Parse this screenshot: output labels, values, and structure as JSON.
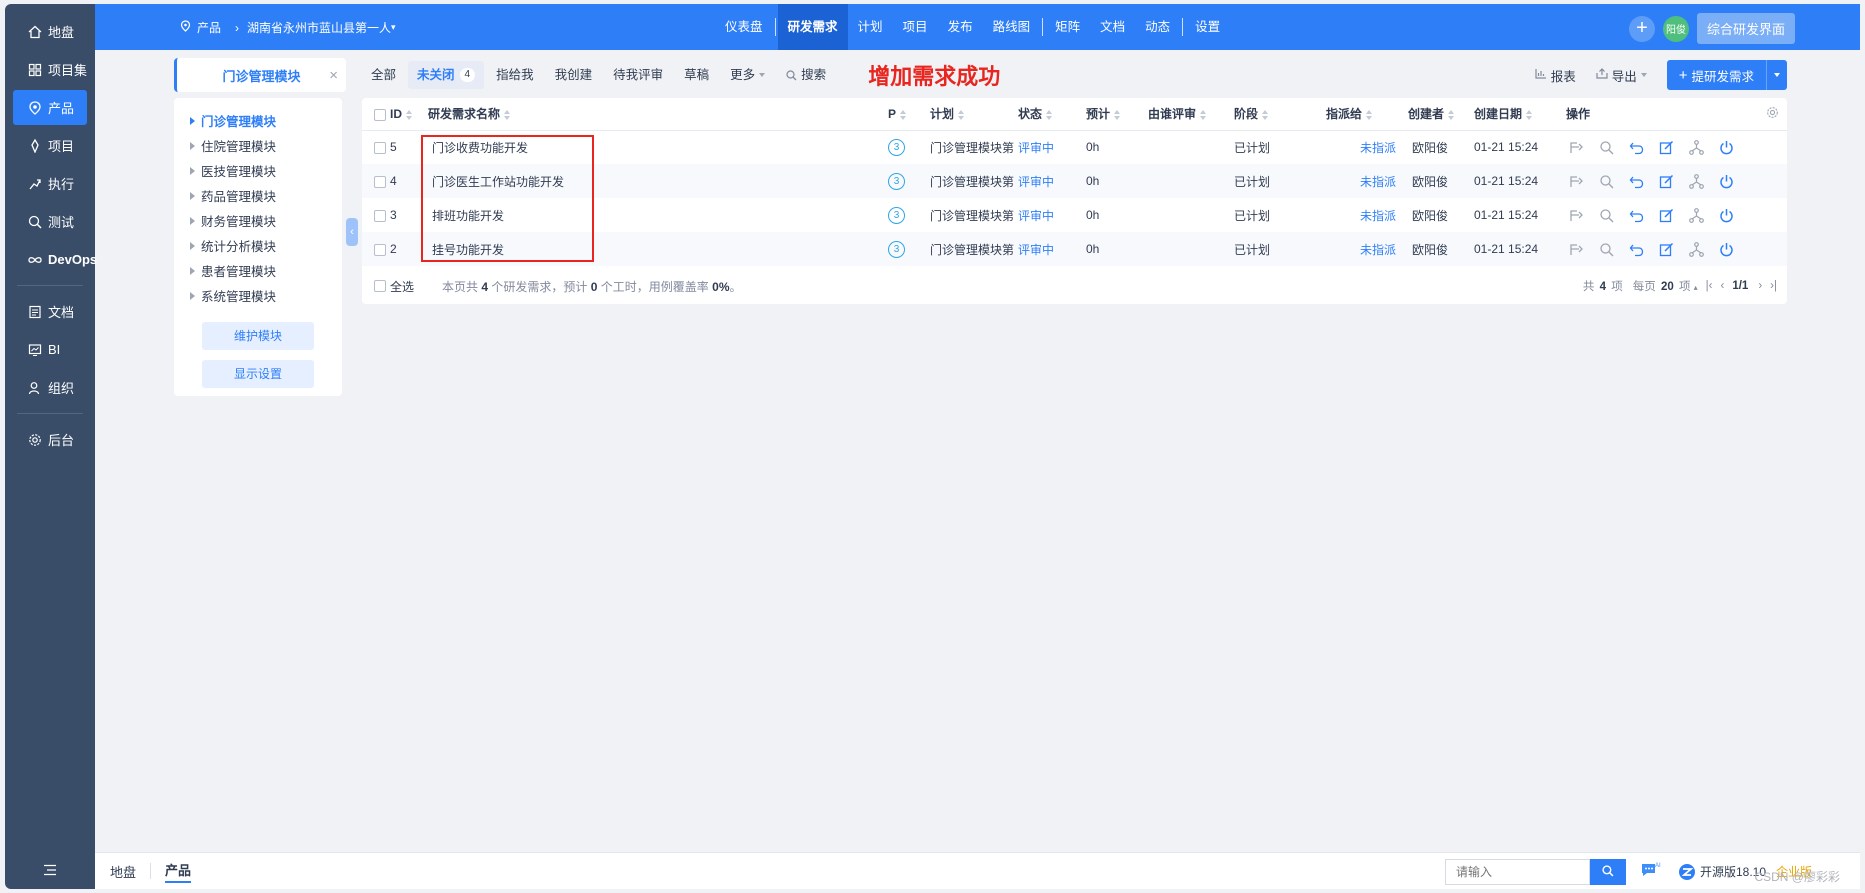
{
  "leftnav": {
    "items": [
      {
        "label": "地盘",
        "icon": "home-icon"
      },
      {
        "label": "项目集",
        "icon": "grid-icon"
      },
      {
        "label": "产品",
        "icon": "product-icon"
      },
      {
        "label": "项目",
        "icon": "project-icon"
      },
      {
        "label": "执行",
        "icon": "run-icon"
      },
      {
        "label": "测试",
        "icon": "test-icon"
      },
      {
        "label": "DevOps",
        "icon": "devops-icon"
      },
      {
        "label": "文档",
        "icon": "doc-icon"
      },
      {
        "label": "BI",
        "icon": "bi-icon"
      },
      {
        "label": "组织",
        "icon": "org-icon"
      },
      {
        "label": "后台",
        "icon": "gear-icon"
      }
    ],
    "active_index": 2
  },
  "header": {
    "product_label": "产品",
    "product_name": "湖南省永州市蓝山县第一人",
    "nav": [
      "仪表盘",
      "研发需求",
      "计划",
      "项目",
      "发布",
      "路线图",
      "矩阵",
      "文档",
      "动态",
      "设置"
    ],
    "active_nav": "研发需求",
    "avatar_text": "阳俊",
    "portal_button": "综合研发界面"
  },
  "module": {
    "title": "门诊管理模块",
    "tree": [
      "门诊管理模块",
      "住院管理模块",
      "医技管理模块",
      "药品管理模块",
      "财务管理模块",
      "统计分析模块",
      "患者管理模块",
      "系统管理模块"
    ],
    "maintain_button": "维护模块",
    "display_button": "显示设置"
  },
  "toolbar": {
    "tabs": [
      "全部",
      "未关闭",
      "指给我",
      "我创建",
      "待我评审",
      "草稿"
    ],
    "active_tab": "未关闭",
    "unclosed_count": "4",
    "more_label": "更多",
    "search_label": "搜索",
    "success_message": "增加需求成功",
    "report_label": "报表",
    "export_label": "导出",
    "create_label": "提研发需求"
  },
  "table": {
    "columns": {
      "id": "ID",
      "name": "研发需求名称",
      "pri": "P",
      "plan": "计划",
      "status": "状态",
      "estimate": "预计",
      "reviewer": "由谁评审",
      "stage": "阶段",
      "assigned": "指派给",
      "creator": "创建者",
      "created": "创建日期",
      "actions": "操作"
    },
    "rows": [
      {
        "id": "5",
        "name": "门诊收费功能开发",
        "pri": "3",
        "plan": "门诊管理模块第",
        "status": "评审中",
        "estimate": "0h",
        "reviewer": "",
        "stage": "已计划",
        "assigned": "未指派",
        "creator": "欧阳俊",
        "created": "01-21 15:24"
      },
      {
        "id": "4",
        "name": "门诊医生工作站功能开发",
        "pri": "3",
        "plan": "门诊管理模块第",
        "status": "评审中",
        "estimate": "0h",
        "reviewer": "",
        "stage": "已计划",
        "assigned": "未指派",
        "creator": "欧阳俊",
        "created": "01-21 15:24"
      },
      {
        "id": "3",
        "name": "排班功能开发",
        "pri": "3",
        "plan": "门诊管理模块第",
        "status": "评审中",
        "estimate": "0h",
        "reviewer": "",
        "stage": "已计划",
        "assigned": "未指派",
        "creator": "欧阳俊",
        "created": "01-21 15:24"
      },
      {
        "id": "2",
        "name": "挂号功能开发",
        "pri": "3",
        "plan": "门诊管理模块第",
        "status": "评审中",
        "estimate": "0h",
        "reviewer": "",
        "stage": "已计划",
        "assigned": "未指派",
        "creator": "欧阳俊",
        "created": "01-21 15:24"
      }
    ],
    "select_all": "全选",
    "summary_prefix": "本页共",
    "summary_count": "4",
    "summary_mid": "个研发需求，预计",
    "summary_hours": "0",
    "summary_mid2": "个工时，用例覆盖率",
    "summary_coverage": "0%",
    "summary_end": "。",
    "pager_total_prefix": "共",
    "pager_total": "4",
    "pager_total_suffix": "项",
    "pager_per_prefix": "每页",
    "pager_per": "20",
    "pager_per_suffix": "项",
    "pager_page": "1/1"
  },
  "footer": {
    "crumb_home": "地盘",
    "crumb_product": "产品",
    "search_placeholder": "请输入",
    "version": "开源版18.10",
    "biz": "企业版",
    "watermark": "CSDN @廖彩彩"
  },
  "colors": {
    "brand": "#2e7ff7",
    "nav_bg": "#3a4d68",
    "success_text": "#e8261f"
  }
}
